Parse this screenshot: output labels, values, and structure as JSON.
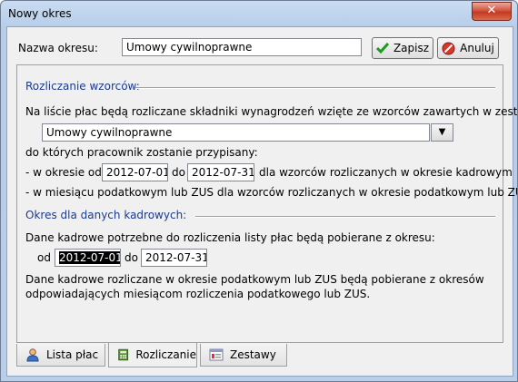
{
  "window": {
    "title": "Nowy okres",
    "close_glyph": "✕"
  },
  "header": {
    "name_label": "Nazwa okresu:",
    "name_value": "Umowy cywilnoprawne",
    "save_label": "Zapisz",
    "cancel_label": "Anuluj"
  },
  "templates": {
    "section_title": "Rozliczanie wzorców:",
    "description": "Na liście płac będą rozliczane składniki wynagrodzeń wzięte ze wzorców zawartych w zestawie:",
    "set_value": "Umowy cywilnoprawne",
    "assigned_text": "do których pracownik zostanie przypisany:",
    "period_prefix": "- w okresie od",
    "date_from": "2012-07-01",
    "to_label": "do",
    "date_to": "2012-07-31",
    "period_suffix": "dla wzorców rozliczanych w okresie kadrowym",
    "tax_month_text": "- w miesiącu podatkowym lub ZUS dla wzorców rozliczanych w okresie podatkowym lub ZUS."
  },
  "hr_period": {
    "section_title": "Okres dla danych kadrowych:",
    "description": "Dane kadrowe potrzebne do rozliczenia listy płac będą pobierane z okresu:",
    "from_label": "od",
    "date_from": "2012-07-01",
    "to_label": "do",
    "date_to": "2012-07-31",
    "note_line1": "Dane kadrowe rozliczane w okresie podatkowym lub ZUS będą pobierane z okresów",
    "note_line2": "odpowiadających miesiącom rozliczenia podatkowego lub ZUS."
  },
  "tabs": [
    {
      "label": "Lista płac",
      "icon": "user-icon",
      "active": false
    },
    {
      "label": "Rozliczanie",
      "icon": "calculator-icon",
      "active": true
    },
    {
      "label": "Zestawy",
      "icon": "sets-icon",
      "active": false
    }
  ],
  "colors": {
    "section_title": "#1a3b8f",
    "selection": "#000000"
  }
}
